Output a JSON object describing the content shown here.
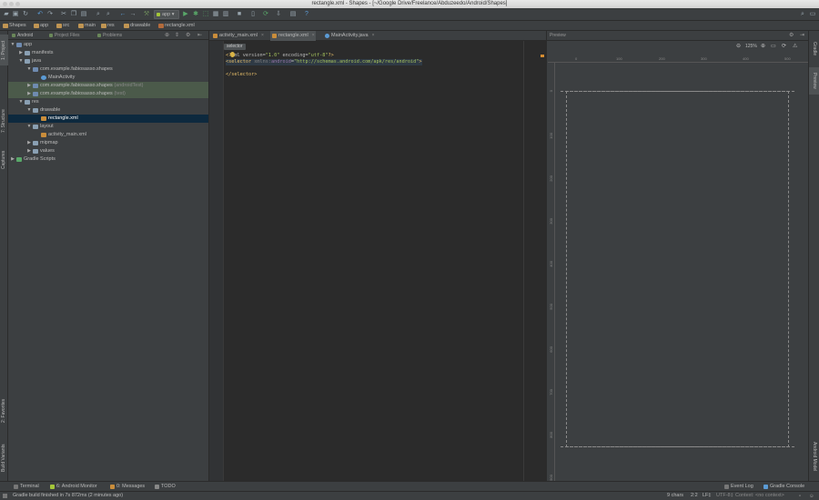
{
  "window": {
    "title": "rectangle.xml - Shapes - [~/Google Drive/Freelance/Abduzeedo/Android/Shapes]"
  },
  "toolbar": {
    "run_config": "app"
  },
  "navbar": {
    "crumbs": [
      "Shapes",
      "app",
      "src",
      "main",
      "res",
      "drawable",
      "rectangle.xml"
    ]
  },
  "left_strip": {
    "project": "1: Project",
    "structure": "7: Structure",
    "captures": "Captures",
    "favorites": "2: Favorites",
    "build_variants": "Build Variants"
  },
  "right_strip": {
    "gradle": "Gradle",
    "preview": "Preview",
    "android_model": "Android Model"
  },
  "project_panel": {
    "tabs": [
      "Android",
      "Project Files",
      "Problems"
    ],
    "tree": [
      {
        "label": "app",
        "level": 0,
        "arrow": "▼"
      },
      {
        "label": "manifests",
        "level": 1,
        "arrow": "▶"
      },
      {
        "label": "java",
        "level": 1,
        "arrow": "▼"
      },
      {
        "label": "com.example.fabiosasso.shapes",
        "level": 2,
        "arrow": "▼"
      },
      {
        "label": "MainActivity",
        "level": 3,
        "arrow": ""
      },
      {
        "label": "com.example.fabiosasso.shapes",
        "suffix": "(androidTest)",
        "level": 2,
        "arrow": "▶"
      },
      {
        "label": "com.example.fabiosasso.shapes",
        "suffix": "(test)",
        "level": 2,
        "arrow": "▶"
      },
      {
        "label": "res",
        "level": 1,
        "arrow": "▼"
      },
      {
        "label": "drawable",
        "level": 2,
        "arrow": "▼"
      },
      {
        "label": "rectangle.xml",
        "level": 3,
        "arrow": ""
      },
      {
        "label": "layout",
        "level": 2,
        "arrow": "▼"
      },
      {
        "label": "activity_main.xml",
        "level": 3,
        "arrow": ""
      },
      {
        "label": "mipmap",
        "level": 2,
        "arrow": "▶"
      },
      {
        "label": "values",
        "level": 2,
        "arrow": "▶"
      },
      {
        "label": "Gradle Scripts",
        "level": 0,
        "arrow": "▶"
      }
    ]
  },
  "editor": {
    "tabs": [
      "activity_main.xml",
      "rectangle.xml",
      "MainActivity.java"
    ],
    "active_tab": "rectangle.xml",
    "breadcrumb": "selector",
    "code": {
      "l1_a": "<?",
      "l1_b": "xml version=",
      "l1_c": "\"1.0\"",
      "l1_d": " encoding=",
      "l1_e": "\"utf-8\"",
      "l1_f": "?>",
      "l2_a": "<selector ",
      "l2_b": "xmlns:",
      "l2_c": "android",
      "l2_d": "=",
      "l2_e": "\"http://schemas.android.com/apk/res/android\"",
      "l2_f": ">",
      "l3": "</selector>"
    }
  },
  "preview": {
    "title": "Preview",
    "zoom": "125%",
    "ruler_top": [
      "0",
      "100",
      "200",
      "300",
      "400",
      "500"
    ],
    "ruler_left": [
      "0",
      "100",
      "200",
      "300",
      "400",
      "500",
      "600",
      "700",
      "800",
      "900"
    ]
  },
  "bottom_tools": {
    "terminal": "Terminal",
    "android_monitor": "6: Android Monitor",
    "messages": "0: Messages",
    "todo": "TODO",
    "event_log": "Event Log",
    "gradle_console": "Gradle Console"
  },
  "status": {
    "message": "Gradle build finished in 7s 872ms (2 minutes ago)",
    "chars": "9 chars",
    "position": "2:2",
    "line_sep": "LF‡",
    "encoding": "UTF-8‡",
    "context": "Context: <no context>"
  },
  "colors": {
    "accent_orange": "#d58c31",
    "selection": "#0d293e",
    "highlight_green": "#4b5a4a"
  }
}
